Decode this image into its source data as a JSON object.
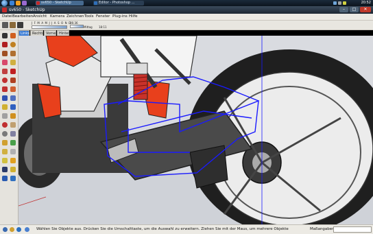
{
  "taskbar": {
    "tasks": [
      {
        "label": "sv650 - SketchUp",
        "active": true
      },
      {
        "label": "Editor - Photoshop ...",
        "active": false
      }
    ],
    "clock": "20:52"
  },
  "window": {
    "title": "sv650 - SketchUp",
    "controls": {
      "minimize": "–",
      "maximize": "□",
      "close": "✕"
    }
  },
  "menu": [
    "Datei",
    "Bearbeiten",
    "Ansicht",
    "Kamera",
    "Zeichnen",
    "Tools",
    "Fenster",
    "Plug-ins",
    "Hilfe"
  ],
  "shadow_settings": {
    "months": "J F M A M J J A S O N D",
    "time_start": "06:36",
    "noon_label": "Mittag",
    "time_end": "18:11"
  },
  "scene_tabs": [
    "Links",
    "Rechts",
    "Vorne",
    "Hinten"
  ],
  "active_scene": "Links",
  "status": {
    "text": "Wählen Sie Objekte aus. Drücken Sie die Umschalttaste, um die Auswahl zu erweitern. Ziehen Sie mit der Maus, um mehrere Objekte",
    "measure_label": "Maßangaben",
    "measure_value": ""
  },
  "colors": {
    "selection": "#1a1aff",
    "fairing": "#e8401c",
    "shock_spring": "#c8322a"
  },
  "icons": {
    "left_toolbar": [
      "select-icon",
      "pencil-icon",
      "rectangle-icon",
      "circle-icon",
      "arc-icon",
      "polygon-icon",
      "eraser-icon",
      "tape-measure-icon",
      "push-pull-icon",
      "move-icon",
      "rotate-icon",
      "follow-me-icon",
      "scale-icon",
      "offset-icon",
      "paint-bucket-icon",
      "protractor-icon",
      "dimension-icon",
      "text-icon",
      "axes-icon",
      "3d-text-icon",
      "orbit-icon",
      "pan-icon",
      "zoom-icon",
      "zoom-window-icon",
      "zoom-extents-icon",
      "previous-view-icon",
      "walk-icon",
      "look-around-icon",
      "position-camera-icon",
      "section-plane-icon",
      "sandbox-icon",
      "layers-icon",
      "components-icon",
      "materials-icon"
    ]
  }
}
